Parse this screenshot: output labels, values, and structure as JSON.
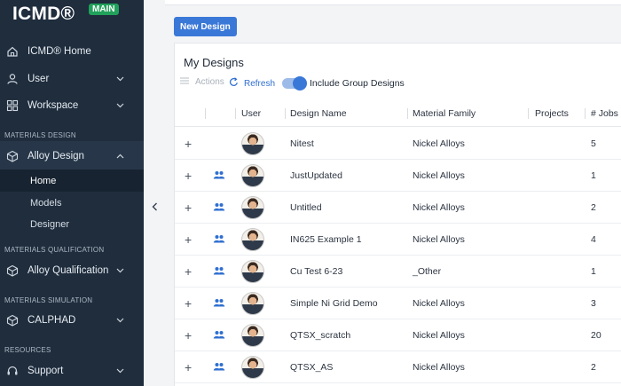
{
  "app": {
    "logo": "ICMD®",
    "badge": "MAIN"
  },
  "sidebar": {
    "items": [
      {
        "label": "ICMD® Home",
        "icon": "home-icon"
      },
      {
        "label": "User",
        "icon": "user-icon"
      },
      {
        "label": "Workspace",
        "icon": "grid-icon"
      }
    ],
    "sections": {
      "materials_design": "MATERIALS DESIGN",
      "materials_qualification": "MATERIALS QUALIFICATION",
      "materials_simulation": "MATERIALS SIMULATION",
      "resources": "RESOURCES"
    },
    "alloy_design": {
      "label": "Alloy Design",
      "icon": "cube-icon"
    },
    "sub_items": [
      {
        "label": "Home"
      },
      {
        "label": "Models"
      },
      {
        "label": "Designer"
      }
    ],
    "alloy_qualification": {
      "label": "Alloy Qualification",
      "icon": "cube-icon"
    },
    "calphad": {
      "label": "CALPHAD",
      "icon": "cube-icon"
    },
    "support": {
      "label": "Support",
      "icon": "headset-icon"
    }
  },
  "main": {
    "new_design_label": "New Design",
    "title": "My Designs",
    "toolbar": {
      "actions_label": "Actions",
      "refresh_label": "Refresh",
      "include_group_label": "Include Group Designs",
      "include_group_on": true
    },
    "table": {
      "headers": [
        "User",
        "Design Name",
        "Material Family",
        "Projects",
        "# Jobs"
      ],
      "rows": [
        {
          "group": false,
          "name": "Nitest",
          "family": "Nickel Alloys",
          "projects": "",
          "jobs": "5"
        },
        {
          "group": true,
          "name": "JustUpdated",
          "family": "Nickel Alloys",
          "projects": "",
          "jobs": "1"
        },
        {
          "group": true,
          "name": "Untitled",
          "family": "Nickel Alloys",
          "projects": "",
          "jobs": "2"
        },
        {
          "group": true,
          "name": "IN625 Example 1",
          "family": "Nickel Alloys",
          "projects": "",
          "jobs": "4"
        },
        {
          "group": true,
          "name": "Cu Test 6-23",
          "family": "_Other",
          "projects": "",
          "jobs": "1"
        },
        {
          "group": true,
          "name": "Simple Ni Grid Demo",
          "family": "Nickel Alloys",
          "projects": "",
          "jobs": "3"
        },
        {
          "group": true,
          "name": "QTSX_scratch",
          "family": "Nickel Alloys",
          "projects": "",
          "jobs": "20"
        },
        {
          "group": true,
          "name": "QTSX_AS",
          "family": "Nickel Alloys",
          "projects": "",
          "jobs": "2"
        }
      ]
    }
  },
  "colors": {
    "sidebar_bg": "#1f2d3d",
    "accent": "#3a78d8",
    "badge_green": "#21a15b"
  }
}
